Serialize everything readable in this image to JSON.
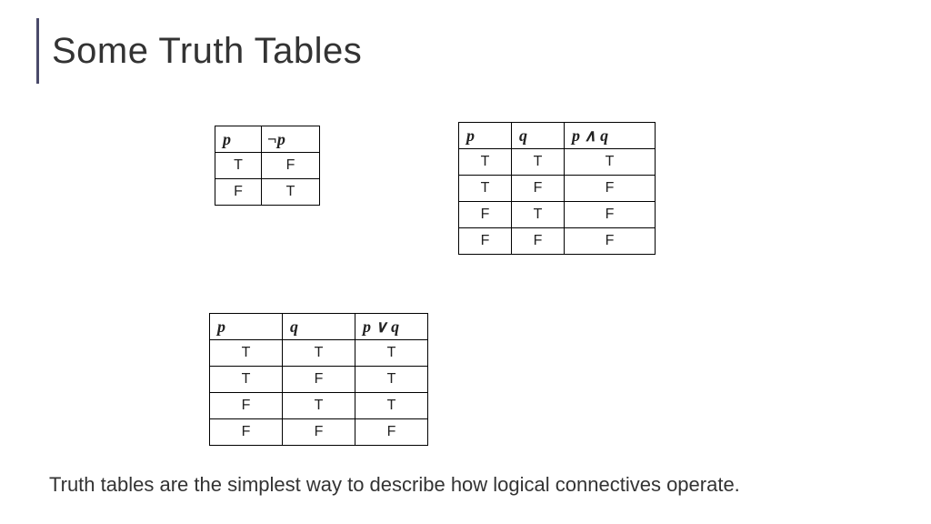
{
  "title": "Some Truth Tables",
  "caption": "Truth tables are the simplest way to describe how logical connectives operate.",
  "chart_data": [
    {
      "type": "table",
      "id": "negation",
      "headers": [
        "p",
        "¬p"
      ],
      "rows": [
        [
          "T",
          "F"
        ],
        [
          "F",
          "T"
        ]
      ]
    },
    {
      "type": "table",
      "id": "conjunction",
      "headers": [
        "p",
        "q",
        "p ∧ q"
      ],
      "rows": [
        [
          "T",
          "T",
          "T"
        ],
        [
          "T",
          "F",
          "F"
        ],
        [
          "F",
          "T",
          "F"
        ],
        [
          "F",
          "F",
          "F"
        ]
      ]
    },
    {
      "type": "table",
      "id": "disjunction",
      "headers": [
        "p",
        "q",
        "p ∨ q"
      ],
      "rows": [
        [
          "T",
          "T",
          "T"
        ],
        [
          "T",
          "F",
          "T"
        ],
        [
          "F",
          "T",
          "T"
        ],
        [
          "F",
          "F",
          "F"
        ]
      ]
    }
  ]
}
